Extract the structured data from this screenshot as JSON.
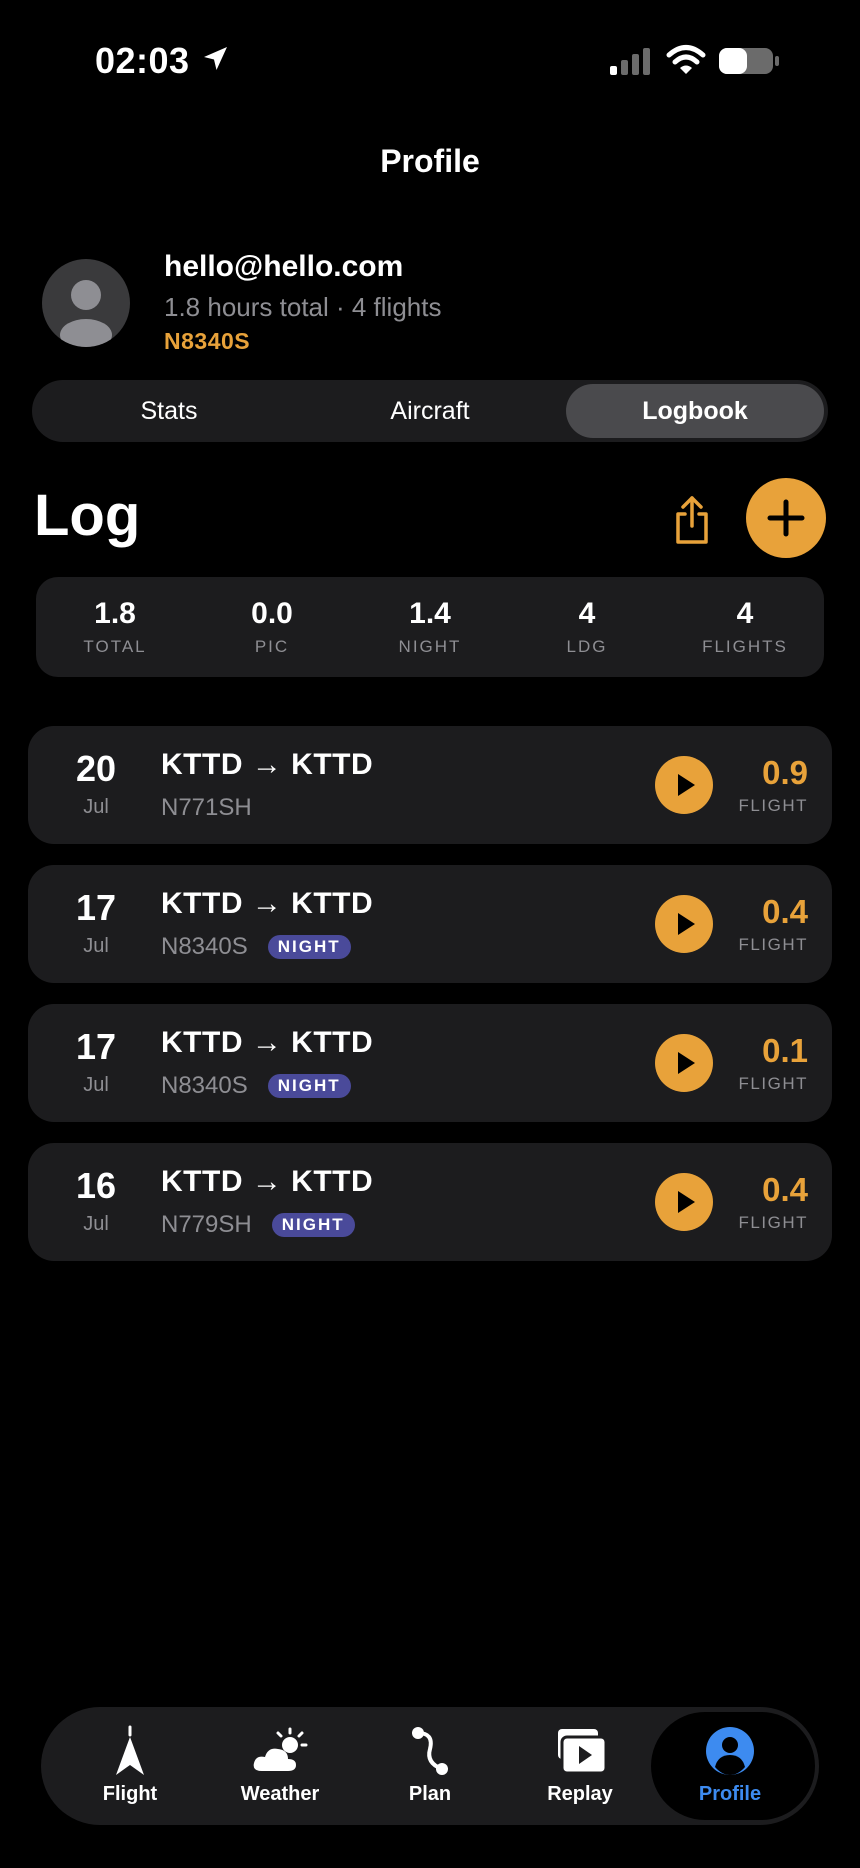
{
  "status_bar": {
    "time": "02:03"
  },
  "header": {
    "title": "Profile"
  },
  "profile": {
    "email": "hello@hello.com",
    "summary": "1.8 hours total · 4 flights",
    "tail": "N8340S"
  },
  "segments": {
    "items": [
      {
        "label": "Stats"
      },
      {
        "label": "Aircraft"
      },
      {
        "label": "Logbook"
      }
    ],
    "selected": "Logbook"
  },
  "log": {
    "title": "Log",
    "stats": [
      {
        "value": "1.8",
        "label": "TOTAL"
      },
      {
        "value": "0.0",
        "label": "PIC"
      },
      {
        "value": "1.4",
        "label": "NIGHT"
      },
      {
        "value": "4",
        "label": "LDG"
      },
      {
        "value": "4",
        "label": "FLIGHTS"
      }
    ],
    "entries": [
      {
        "day": "20",
        "month": "Jul",
        "route": "KTTD → KTTD",
        "tail": "N771SH",
        "badge": "",
        "hours": "0.9",
        "hours_label": "FLIGHT"
      },
      {
        "day": "17",
        "month": "Jul",
        "route": "KTTD → KTTD",
        "tail": "N8340S",
        "badge": "NIGHT",
        "hours": "0.4",
        "hours_label": "FLIGHT"
      },
      {
        "day": "17",
        "month": "Jul",
        "route": "KTTD → KTTD",
        "tail": "N8340S",
        "badge": "NIGHT",
        "hours": "0.1",
        "hours_label": "FLIGHT"
      },
      {
        "day": "16",
        "month": "Jul",
        "route": "KTTD → KTTD",
        "tail": "N779SH",
        "badge": "NIGHT",
        "hours": "0.4",
        "hours_label": "FLIGHT"
      }
    ]
  },
  "tabbar": {
    "items": [
      {
        "label": "Flight",
        "icon": "flight-icon"
      },
      {
        "label": "Weather",
        "icon": "weather-icon"
      },
      {
        "label": "Plan",
        "icon": "plan-icon"
      },
      {
        "label": "Replay",
        "icon": "replay-icon"
      },
      {
        "label": "Profile",
        "icon": "profile-icon"
      }
    ],
    "selected": "Profile"
  },
  "colors": {
    "accent": "#e8a23a",
    "night_badge": "#4a4a9a",
    "active_tab": "#3d8bf0",
    "card": "#1c1c1e"
  }
}
